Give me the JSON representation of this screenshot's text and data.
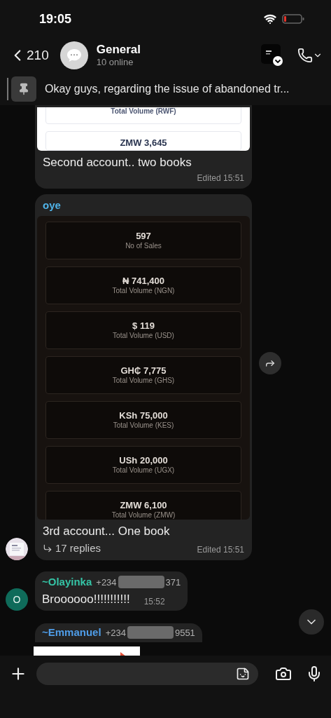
{
  "status_bar": {
    "time": "19:05"
  },
  "header": {
    "back_count": "210",
    "title": "General",
    "subtitle": "10 online"
  },
  "pinned": {
    "text": "Okay guys, regarding the issue of abandoned tr..."
  },
  "messages": [
    {
      "image": {
        "kind": "light",
        "cards": [
          {
            "label": "Total Volume (RWF)"
          },
          {
            "value": "ZMW 3,645"
          }
        ]
      },
      "text": "Second account.. two books",
      "time": "Edited 15:51"
    },
    {
      "sender": "oye",
      "color": "#4fb3e8",
      "image": {
        "kind": "dark",
        "cards": [
          {
            "value": "597",
            "label": "No of Sales"
          },
          {
            "value": "₦ 741,400",
            "label": "Total Volume (NGN)"
          },
          {
            "value": "$ 119",
            "label": "Total Volume (USD)"
          },
          {
            "value": "GH₵ 7,775",
            "label": "Total Volume (GHS)"
          },
          {
            "value": "KSh 75,000",
            "label": "Total Volume (KES)"
          },
          {
            "value": "USh 20,000",
            "label": "Total Volume (UGX)"
          },
          {
            "value": "ZMW 6,100",
            "label": "Total Volume (ZMW)"
          }
        ]
      },
      "text": "3rd account... One book",
      "replies": "17 replies",
      "time": "Edited 15:51",
      "forward": true
    },
    {
      "kind": "text",
      "sender": "~Olayinka",
      "color": "#35c4a6",
      "phone_start": "+234",
      "phone_end": "371",
      "text": "Broooooo!!!!!!!!!!!",
      "time": "15:52",
      "avatar": {
        "kind": "letter",
        "letter": "O"
      }
    },
    {
      "kind": "image_partial",
      "sender": "~Emmanuel",
      "color": "#4f9de8",
      "phone_start": "+234",
      "phone_end": "9551"
    }
  ]
}
